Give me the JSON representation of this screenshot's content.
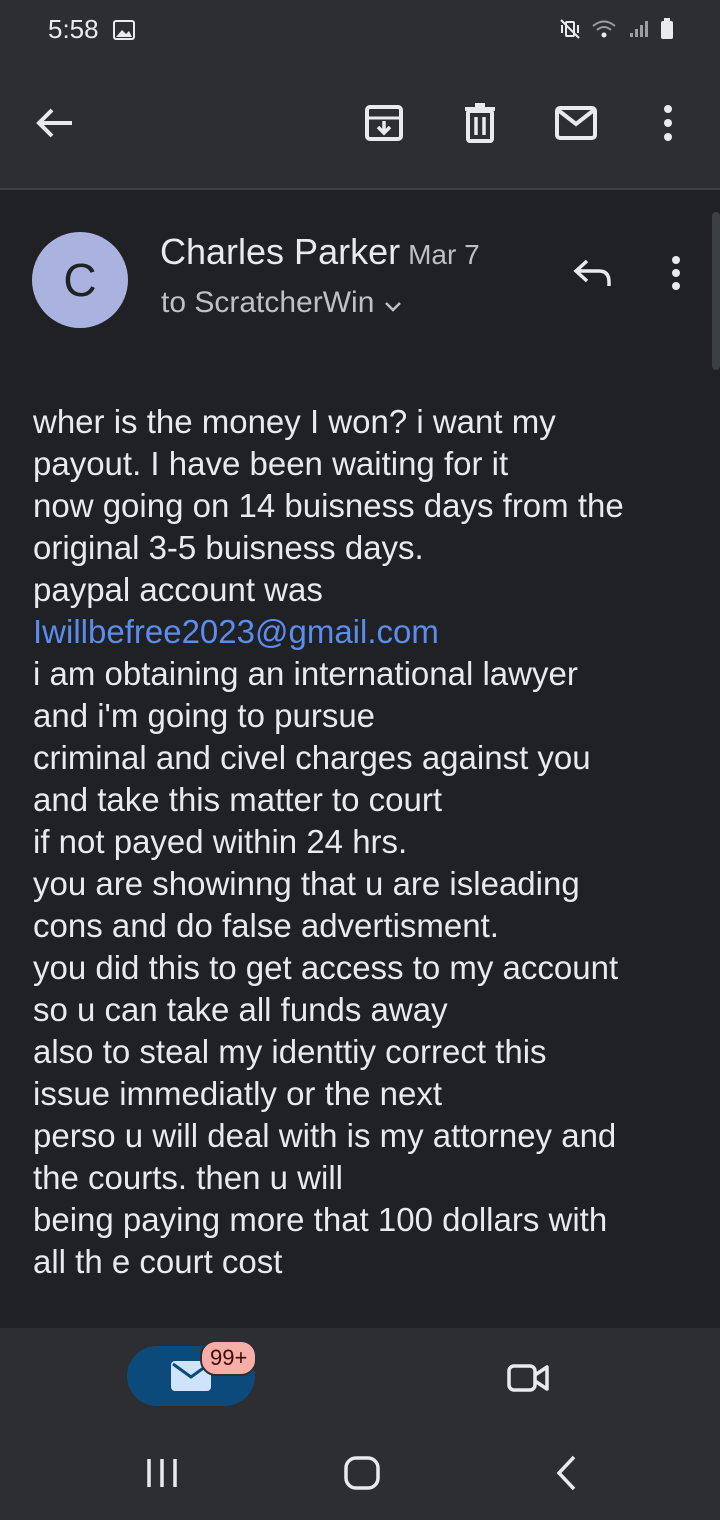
{
  "status_bar": {
    "time": "5:58",
    "icons": [
      "image-icon",
      "mute-vibrate-icon",
      "wifi-icon",
      "signal-icon",
      "battery-icon"
    ]
  },
  "toolbar": {
    "actions": [
      "back-arrow-icon",
      "archive-icon",
      "delete-icon",
      "mark-unread-icon",
      "more-vert-icon"
    ]
  },
  "message": {
    "avatar_letter": "C",
    "avatar_color": "#aab2e0",
    "sender": "Charles Parker",
    "date": "Mar 7",
    "recipient": "to ScratcherWin",
    "body_lines": [
      "wher is the money I won? i want my",
      "payout. I have been waiting for it",
      "now going on 14 buisness days from the",
      "original 3-5 buisness days.",
      "paypal account was",
      "Iwillbefree2023@gmail.com",
      "i am obtaining an international lawyer",
      "and i'm going to pursue",
      "criminal and civel charges against you",
      "and take this matter to court",
      "if not payed within 24 hrs.",
      "you are showinng that u are isleading",
      "cons and do false advertisment.",
      "you did this to get access to my account",
      "so u can take all funds away",
      "also to steal my identtiy correct this",
      "issue immediatly or the next",
      "perso u will deal with is my attorney and",
      "the courts. then u will",
      "being paying more that 100 dollars with",
      "all th e court cost"
    ],
    "link_color": "#5b8def"
  },
  "bottom_nav": {
    "mail_badge": "99+",
    "accent": "#0b4a7a"
  }
}
